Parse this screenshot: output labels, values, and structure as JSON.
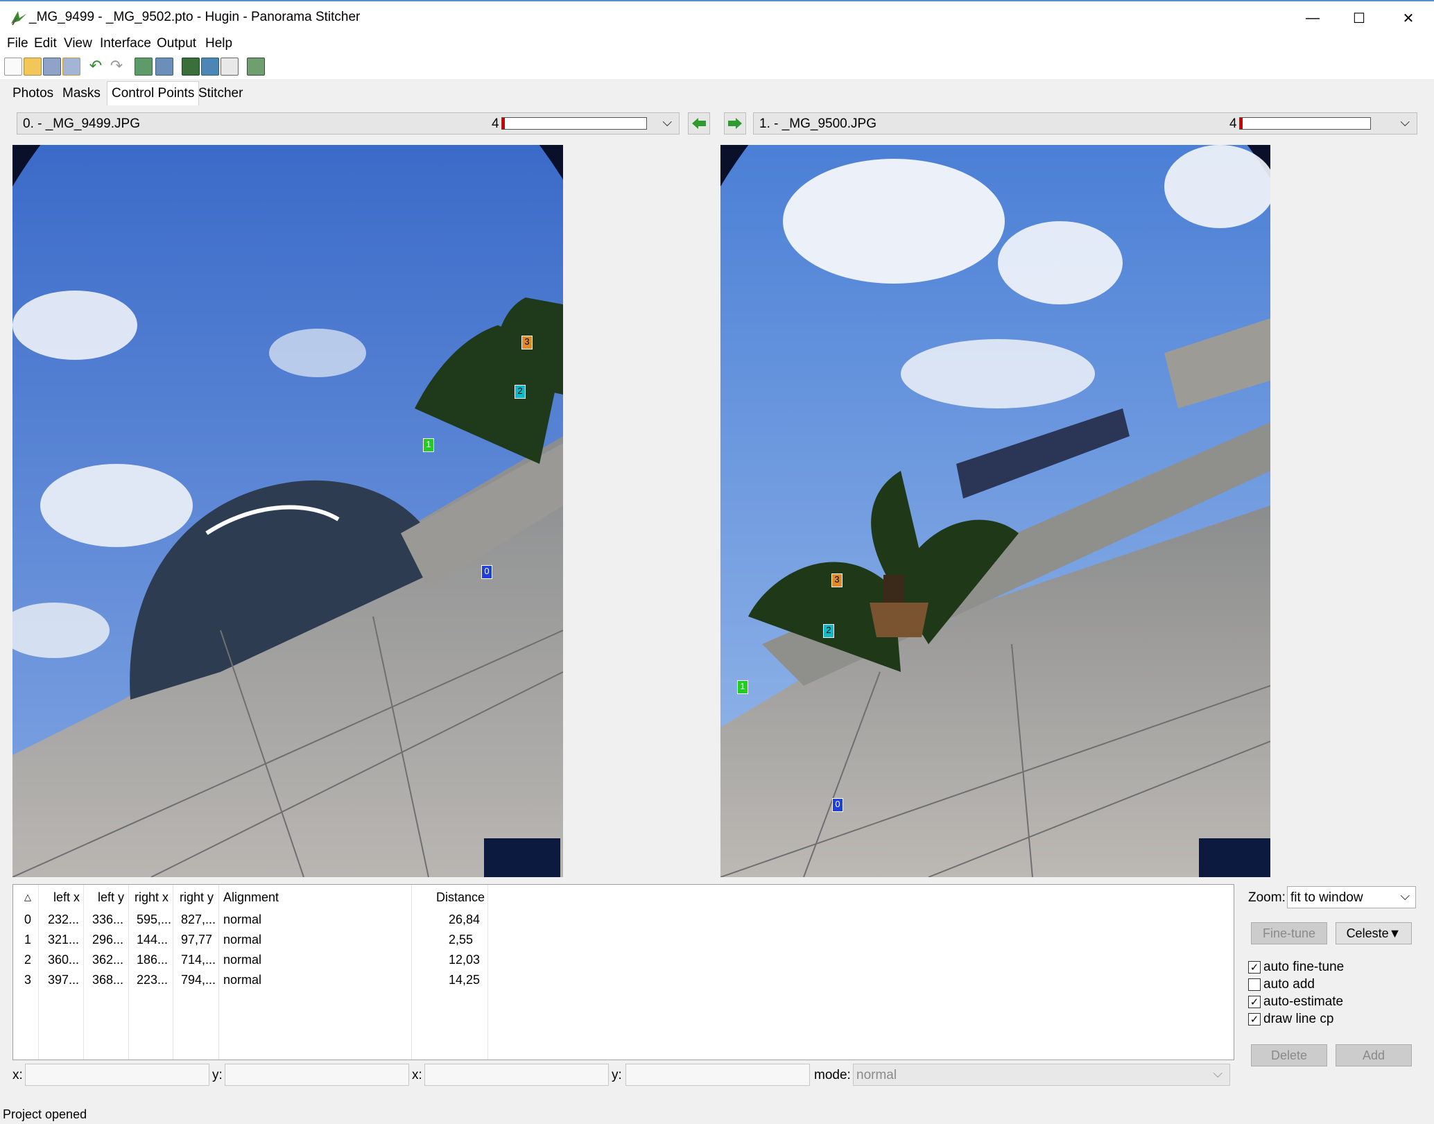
{
  "window": {
    "title": "_MG_9499 - _MG_9502.pto - Hugin - Panorama Stitcher",
    "minimize": "—",
    "maximize": "☐",
    "close": "✕"
  },
  "menu": [
    "File",
    "Edit",
    "View",
    "Interface",
    "Output",
    "Help"
  ],
  "toolbar_icons": [
    "new-project-icon",
    "open-project-icon",
    "save-icon",
    "save-as-icon",
    "undo-icon",
    "redo-icon",
    "add-images-icon",
    "add-images-series-icon",
    "optimize-icon",
    "preview-icon",
    "fast-preview-icon",
    "layout-icon"
  ],
  "tabs": [
    "Photos",
    "Masks",
    "Control Points",
    "Stitcher"
  ],
  "active_tab": "Control Points",
  "left_image": {
    "label": "0. - _MG_9499.JPG",
    "cp_count": "4",
    "quality_fraction": 0.02
  },
  "right_image": {
    "label": "1. - _MG_9500.JPG",
    "cp_count": "4",
    "quality_fraction": 0.02
  },
  "nav": {
    "prev_icon": "arrow-left-icon",
    "next_icon": "arrow-right-icon"
  },
  "cp_markers_left": [
    "0",
    "1",
    "2",
    "3"
  ],
  "cp_markers_right": [
    "0",
    "1",
    "2",
    "3"
  ],
  "cp_table": {
    "sort_indicator": "△",
    "headers": [
      "left x",
      "left y",
      "right x",
      "right y",
      "Alignment",
      "Distance"
    ],
    "rows": [
      {
        "id": "0",
        "lx": "232...",
        "ly": "336...",
        "rx": "595,...",
        "ry": "827,...",
        "align": "normal",
        "dist": "26,84"
      },
      {
        "id": "1",
        "lx": "321...",
        "ly": "296...",
        "rx": "144...",
        "ry": "97,77",
        "align": "normal",
        "dist": "2,55"
      },
      {
        "id": "2",
        "lx": "360...",
        "ly": "362...",
        "rx": "186...",
        "ry": "714,...",
        "align": "normal",
        "dist": "12,03"
      },
      {
        "id": "3",
        "lx": "397...",
        "ly": "368...",
        "rx": "223...",
        "ry": "794,...",
        "align": "normal",
        "dist": "14,25"
      }
    ]
  },
  "zoom": {
    "label": "Zoom:",
    "value": "fit to window"
  },
  "buttons": {
    "fine_tune": "Fine-tune",
    "celeste": "Celeste▼",
    "delete": "Delete",
    "add": "Add"
  },
  "checkboxes": [
    {
      "label": "auto fine-tune",
      "checked": true
    },
    {
      "label": "auto add",
      "checked": false
    },
    {
      "label": "auto-estimate",
      "checked": true
    },
    {
      "label": "draw line cp",
      "checked": true
    }
  ],
  "bottom": {
    "x_label": "x:",
    "y_label": "y:",
    "x2_label": "x:",
    "y2_label": "y:",
    "mode_label": "mode:",
    "mode_value": "normal"
  },
  "status": "Project opened",
  "colors": {
    "cp0": "#1f3fd8",
    "cp1": "#22cc22",
    "cp2": "#11b8c8",
    "cp3": "#e08a2a",
    "quality_bar": "#cc0000"
  }
}
